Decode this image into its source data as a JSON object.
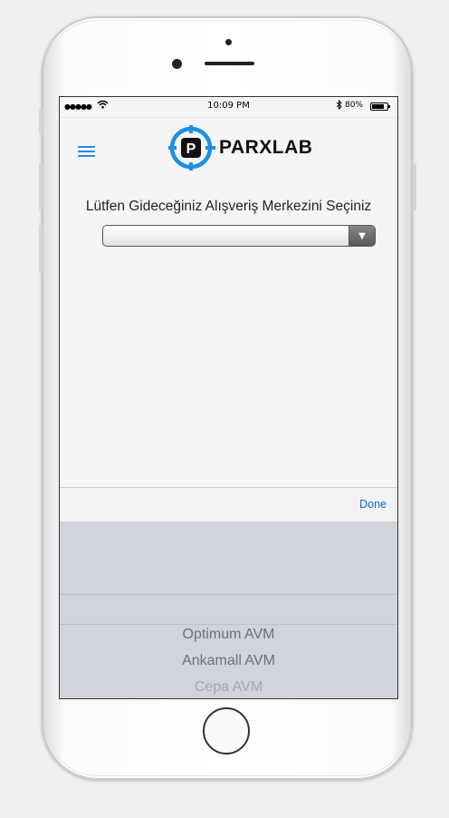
{
  "status_bar": {
    "signal": "●●●●●",
    "time": "10:09 PM",
    "battery_percent": "80%",
    "battery_level": 0.8
  },
  "header": {
    "logo_text": "PARXLAB",
    "logo_letter": "P",
    "accent_color": "#1f8fe0"
  },
  "form": {
    "prompt": "Lütfen Gideceğiniz Alışveriş Merkezini Seçiniz",
    "selected_value": ""
  },
  "picker": {
    "done_label": "Done",
    "options": [
      "Optimum AVM",
      "Ankamall AVM",
      "Cepa AVM"
    ]
  }
}
